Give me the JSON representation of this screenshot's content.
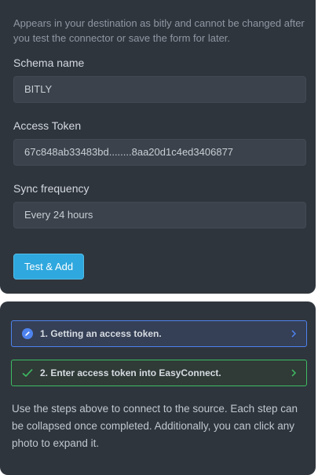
{
  "connector_form": {
    "destination_hint": "Appears in your destination as bitly and cannot be changed after you test the connector or save the form for later.",
    "schema": {
      "label": "Schema name",
      "value": "BITLY"
    },
    "access_token": {
      "label": "Access Token",
      "value": "67c848ab33483bd........8aa20d1c4ed3406877"
    },
    "sync_frequency": {
      "label": "Sync frequency",
      "value": "Every 24 hours"
    },
    "submit_label": "Test & Add"
  },
  "setup_guide": {
    "steps": [
      {
        "label": "1. Getting an access token.",
        "status": "in-progress",
        "icon": "edit-icon",
        "color": "#4e83ee"
      },
      {
        "label": "2. Enter access token into EasyConnect.",
        "status": "complete",
        "icon": "check-icon",
        "color": "#3dbd62"
      }
    ],
    "description": "Use the steps above to connect to the source. Each step can be collapsed once completed. Additionally, you can click any photo to expand it."
  }
}
